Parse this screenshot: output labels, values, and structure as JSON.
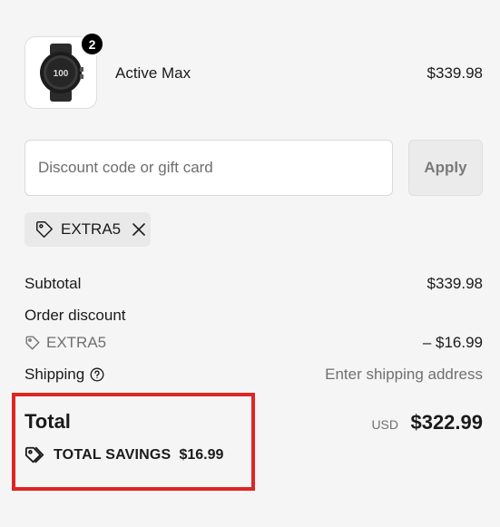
{
  "product": {
    "name": "Active Max",
    "price": "$339.98",
    "quantity": "2",
    "watch_face_text": "100"
  },
  "discount": {
    "placeholder": "Discount code or gift card",
    "value": "",
    "apply_label": "Apply",
    "applied_code": "EXTRA5"
  },
  "summary": {
    "subtotal_label": "Subtotal",
    "subtotal_value": "$339.98",
    "order_discount_label": "Order discount",
    "order_discount_code": "EXTRA5",
    "order_discount_value": "– $16.99",
    "shipping_label": "Shipping",
    "shipping_value": "Enter shipping address"
  },
  "total": {
    "label": "Total",
    "currency": "USD",
    "amount": "$322.99",
    "savings_label": "TOTAL SAVINGS",
    "savings_value": "$16.99"
  },
  "colors": {
    "highlight": "#e02424",
    "badge": "#000000",
    "background": "#f5f5f5"
  },
  "icons": [
    "smartwatch-image",
    "tag-icon",
    "close-icon",
    "help-icon",
    "tags-icon"
  ]
}
